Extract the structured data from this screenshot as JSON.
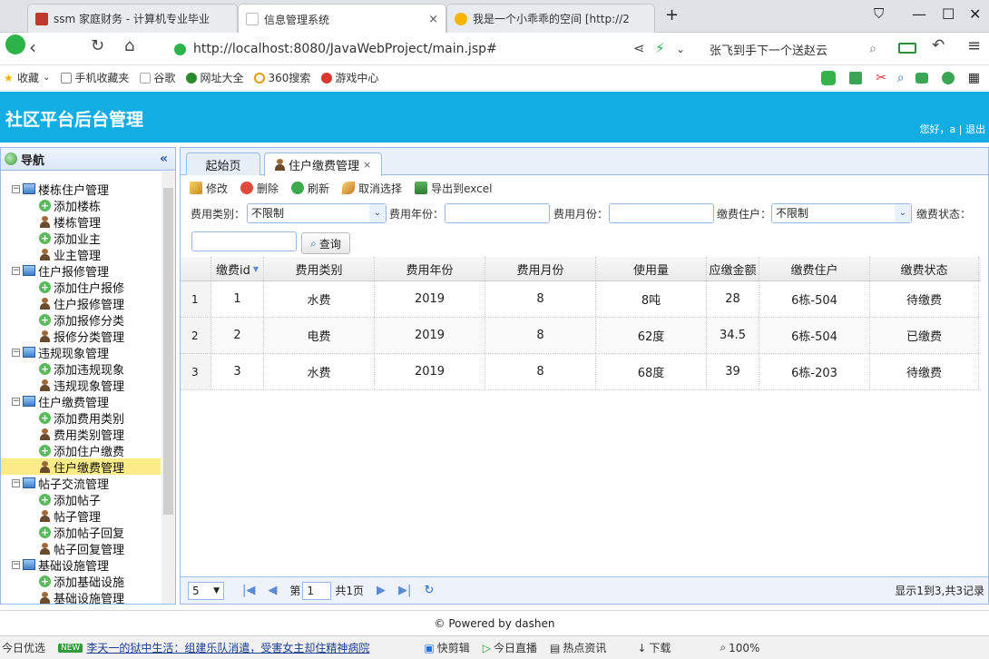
{
  "browser": {
    "tabs": [
      {
        "title": "ssm 家庭财务 - 计算机专业毕业"
      },
      {
        "title": "信息管理系统"
      },
      {
        "title": "我是一个小乖乖的空间 [http://2"
      }
    ],
    "url": "http://localhost:8080/JavaWebProject/main.jsp#",
    "search_text": "张飞到手下一个送赵云"
  },
  "bookmarks": [
    "收藏",
    "手机收藏夹",
    "谷歌",
    "网址大全",
    "360搜索",
    "游戏中心"
  ],
  "header": {
    "title": "社区平台后台管理",
    "greeting": "您好，a | 退出"
  },
  "sidebar": {
    "title": "导航",
    "tree": [
      {
        "label": "楼栋住户管理",
        "kind": "group"
      },
      {
        "label": "添加楼栋",
        "kind": "add"
      },
      {
        "label": "楼栋管理",
        "kind": "user"
      },
      {
        "label": "添加业主",
        "kind": "add"
      },
      {
        "label": "业主管理",
        "kind": "user"
      },
      {
        "label": "住户报修管理",
        "kind": "group"
      },
      {
        "label": "添加住户报修",
        "kind": "add"
      },
      {
        "label": "住户报修管理",
        "kind": "user"
      },
      {
        "label": "添加报修分类",
        "kind": "add"
      },
      {
        "label": "报修分类管理",
        "kind": "user"
      },
      {
        "label": "违规现象管理",
        "kind": "group"
      },
      {
        "label": "添加违规现象",
        "kind": "add"
      },
      {
        "label": "违规现象管理",
        "kind": "user"
      },
      {
        "label": "住户缴费管理",
        "kind": "group"
      },
      {
        "label": "添加费用类别",
        "kind": "add"
      },
      {
        "label": "费用类别管理",
        "kind": "user"
      },
      {
        "label": "添加住户缴费",
        "kind": "add"
      },
      {
        "label": "住户缴费管理",
        "kind": "user",
        "selected": true
      },
      {
        "label": "帖子交流管理",
        "kind": "group"
      },
      {
        "label": "添加帖子",
        "kind": "add"
      },
      {
        "label": "帖子管理",
        "kind": "user"
      },
      {
        "label": "添加帖子回复",
        "kind": "add"
      },
      {
        "label": "帖子回复管理",
        "kind": "user"
      },
      {
        "label": "基础设施管理",
        "kind": "group"
      },
      {
        "label": "添加基础设施",
        "kind": "add"
      },
      {
        "label": "基础设施管理",
        "kind": "user"
      }
    ]
  },
  "tabs": {
    "home": "起始页",
    "current": "住户缴费管理",
    "close": "×"
  },
  "toolbar": {
    "edit": "修改",
    "delete": "删除",
    "refresh": "刷新",
    "cancel": "取消选择",
    "export": "导出到excel"
  },
  "filters": {
    "fee_type_label": "费用类别：",
    "fee_type_value": "不限制",
    "fee_year_label": "费用年份：",
    "fee_month_label": "费用月份：",
    "payer_label": "缴费住户：",
    "payer_value": "不限制",
    "status_label": "缴费状态：",
    "query": "查询"
  },
  "grid": {
    "headers": [
      "缴费id",
      "费用类别",
      "费用年份",
      "费用月份",
      "使用量",
      "应缴金额",
      "缴费住户",
      "缴费状态"
    ],
    "rows": [
      {
        "n": "1",
        "cells": [
          "1",
          "水费",
          "2019",
          "8",
          "8吨",
          "28",
          "6栋-504",
          "待缴费"
        ]
      },
      {
        "n": "2",
        "cells": [
          "2",
          "电费",
          "2019",
          "8",
          "62度",
          "34.5",
          "6栋-504",
          "已缴费"
        ]
      },
      {
        "n": "3",
        "cells": [
          "3",
          "水费",
          "2019",
          "8",
          "68度",
          "39",
          "6栋-203",
          "待缴费"
        ]
      }
    ]
  },
  "pager": {
    "page_size": "5",
    "page_label_pre": "第",
    "page_value": "1",
    "page_label_post": "共1页",
    "info": "显示1到3,共3记录"
  },
  "footer": "© Powered by dashen",
  "statusbar": {
    "left": "今日优选",
    "badge": "NEW",
    "news": "李天一的狱中生活：组建乐队消遣，受害女主却住精神病院",
    "items": [
      "快剪辑",
      "今日直播",
      "热点资讯",
      "下载"
    ],
    "zoom": "100%"
  }
}
